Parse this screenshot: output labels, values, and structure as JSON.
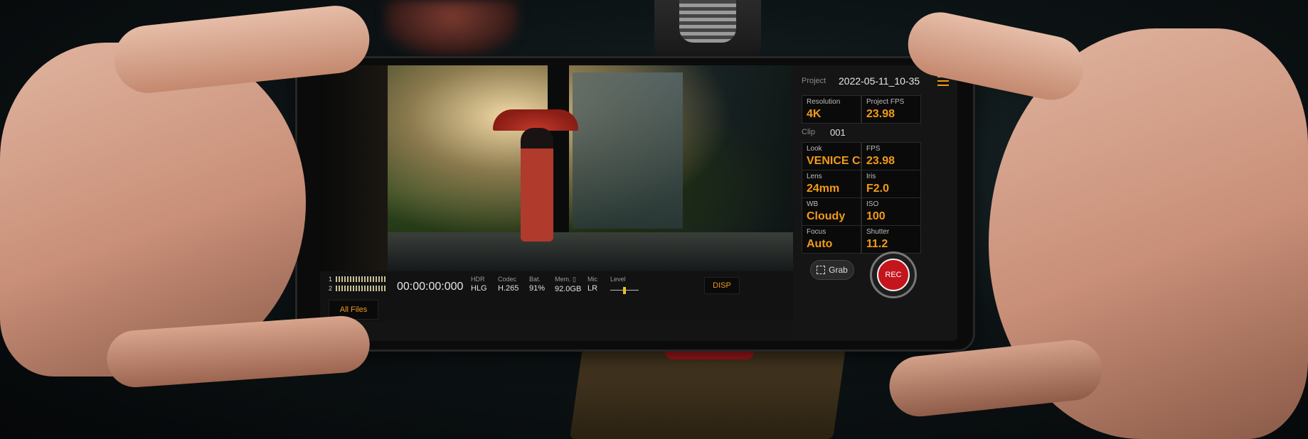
{
  "project": {
    "label": "Project",
    "value": "2022-05-11_10-35"
  },
  "settings_top": [
    {
      "label": "Resolution",
      "value": "4K"
    },
    {
      "label": "Project FPS",
      "value": "23.98"
    }
  ],
  "clip": {
    "label": "Clip",
    "value": "001"
  },
  "settings_grid": [
    {
      "label": "Look",
      "value": "VENICE CS"
    },
    {
      "label": "FPS",
      "value": "23.98"
    },
    {
      "label": "Lens",
      "value": "24mm"
    },
    {
      "label": "Iris",
      "value": "F2.0"
    },
    {
      "label": "WB",
      "value": "Cloudy"
    },
    {
      "label": "ISO",
      "value": "100"
    },
    {
      "label": "Focus",
      "value": "Auto"
    },
    {
      "label": "Shutter",
      "value": "11.2"
    }
  ],
  "status": {
    "timecode": "00:00:00:000",
    "audio_channels": [
      "1",
      "2"
    ],
    "items": [
      {
        "label": "HDR",
        "value": "HLG"
      },
      {
        "label": "Codec",
        "value": "H.265"
      },
      {
        "label": "Bat.",
        "value": "91%"
      },
      {
        "label": "Mem. ▯",
        "value": "92.0GB"
      },
      {
        "label": "Mic",
        "value": "LR"
      }
    ],
    "level_label": "Level",
    "level": 0.5
  },
  "buttons": {
    "all_files": "All Files",
    "disp": "DISP",
    "grab": "Grab",
    "rec": "REC"
  },
  "colors": {
    "accent": "#f29a16",
    "record": "#c4141c"
  },
  "icons": [
    "menu-icon",
    "grab-icon",
    "level-icon",
    "record-icon"
  ]
}
